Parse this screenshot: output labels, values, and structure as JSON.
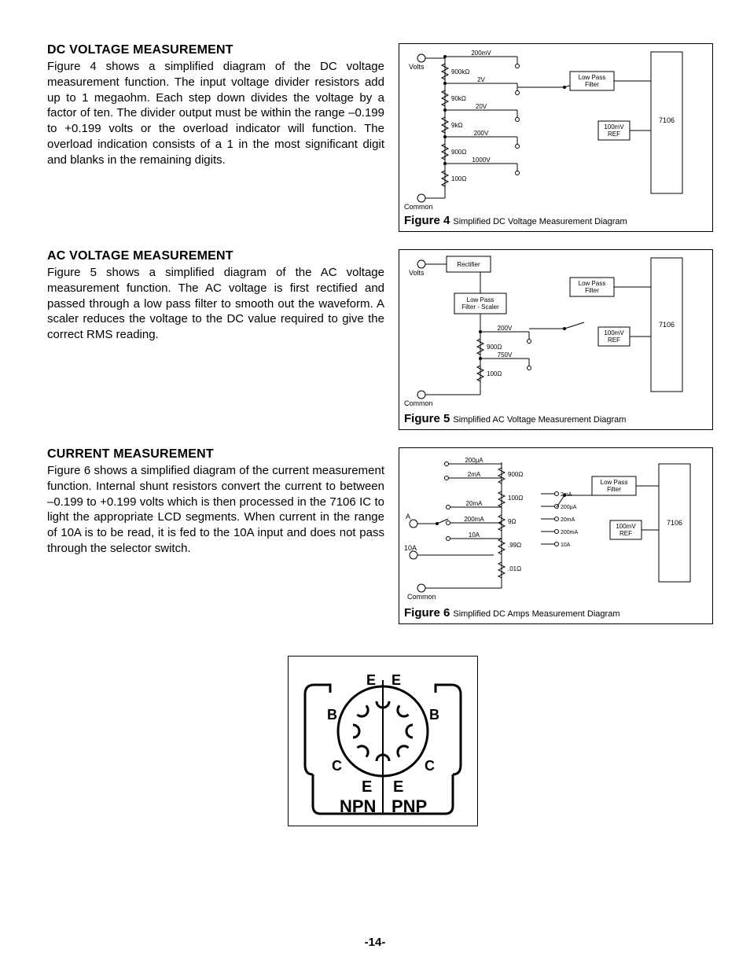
{
  "page_number": "-14-",
  "sections": [
    {
      "heading": "DC VOLTAGE MEASUREMENT",
      "body": "Figure 4 shows a simplified diagram of the DC voltage measurement function. The input voltage divider resistors add up to 1 megaohm. Each step down divides the voltage by a factor of ten. The divider output must be within the range –0.199 to +0.199 volts or the overload indicator will function. The overload indication consists of a 1 in the most significant digit and blanks in the remaining digits."
    },
    {
      "heading": "AC VOLTAGE MEASUREMENT",
      "body": "Figure 5 shows a simplified diagram of the AC voltage measurement function. The AC voltage is first rectified and passed through a low pass filter to smooth out the waveform. A scaler reduces the voltage to the DC value required to give the correct RMS reading."
    },
    {
      "heading": "CURRENT MEASUREMENT",
      "body": "Figure 6 shows a simplified diagram of the current measurement function. Internal shunt resistors convert the current to between –0.199 to +0.199 volts which is then processed in the 7106 IC to light the appropriate LCD segments. When current in the range of 10A is to be read, it is fed to the 10A input and does not pass through the selector switch."
    }
  ],
  "figures": [
    {
      "num": "Figure 4",
      "title": "Simplified DC Voltage Measurement Diagram"
    },
    {
      "num": "Figure 5",
      "title": "Simplified AC Voltage Measurement Diagram"
    },
    {
      "num": "Figure 6",
      "title": "Simplified DC Amps Measurement Diagram"
    }
  ],
  "fig4": {
    "terminals": {
      "top": "Volts",
      "bottom": "Common"
    },
    "ladder": [
      {
        "label": "900kΩ",
        "range": "200mV"
      },
      {
        "label": "90kΩ",
        "range": "2V"
      },
      {
        "label": "9kΩ",
        "range": "20V"
      },
      {
        "label": "900Ω",
        "range": "200V"
      },
      {
        "label": "100Ω",
        "range": "1000V"
      }
    ],
    "blocks": {
      "lpf": "Low Pass\nFilter",
      "ref": "100mV\nREF",
      "ic": "7106"
    }
  },
  "fig5": {
    "terminals": {
      "top": "Volts",
      "bottom": "Common"
    },
    "top_block": "Rectifier",
    "mid_block": "Low Pass\nFilter - Scaler",
    "ladder": [
      {
        "label": "900Ω",
        "range": "200V"
      },
      {
        "label": "100Ω",
        "range": "750V"
      }
    ],
    "blocks": {
      "lpf": "Low Pass\nFilter",
      "ref": "100mV\nREF",
      "ic": "7106"
    }
  },
  "fig6": {
    "terminals": {
      "a": "A",
      "tenA": "10A",
      "common": "Common"
    },
    "top_ranges": [
      "200μA",
      "2mA"
    ],
    "row_ranges": [
      "20mA",
      "200mA",
      "10A"
    ],
    "shunts": [
      "900Ω",
      "100Ω",
      "9Ω",
      ".99Ω",
      ".01Ω"
    ],
    "sw_labels": [
      "2mA",
      "200μA",
      "20mA",
      "200mA",
      "10A"
    ],
    "blocks": {
      "lpf": "Low Pass\nFilter",
      "ref": "100mV\nREF",
      "ic": "7106"
    }
  },
  "socket": {
    "pins_top": [
      "E",
      "E"
    ],
    "pins_side": [
      "B",
      "B"
    ],
    "pins_low": [
      "C",
      "C"
    ],
    "pins_bottom": [
      "E",
      "E"
    ],
    "labels": [
      "NPN",
      "PNP"
    ]
  }
}
